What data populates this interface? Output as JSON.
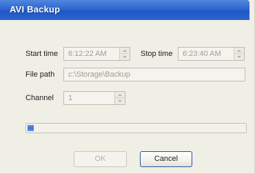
{
  "window": {
    "title": "AVI Backup"
  },
  "form": {
    "start_time_label": "Start time",
    "start_time_value": "6:12:22 AM",
    "stop_time_label": "Stop time",
    "stop_time_value": "6:23:40 AM",
    "file_path_label": "File path",
    "file_path_value": "c:\\Storage\\Backup",
    "channel_label": "Channel",
    "channel_value": "1"
  },
  "progress": {
    "fraction": 0.03
  },
  "buttons": {
    "ok_label": "OK",
    "cancel_label": "Cancel"
  },
  "colors": {
    "titlebar": "#2f66cf",
    "progress_fill": "#3c6fd6"
  }
}
